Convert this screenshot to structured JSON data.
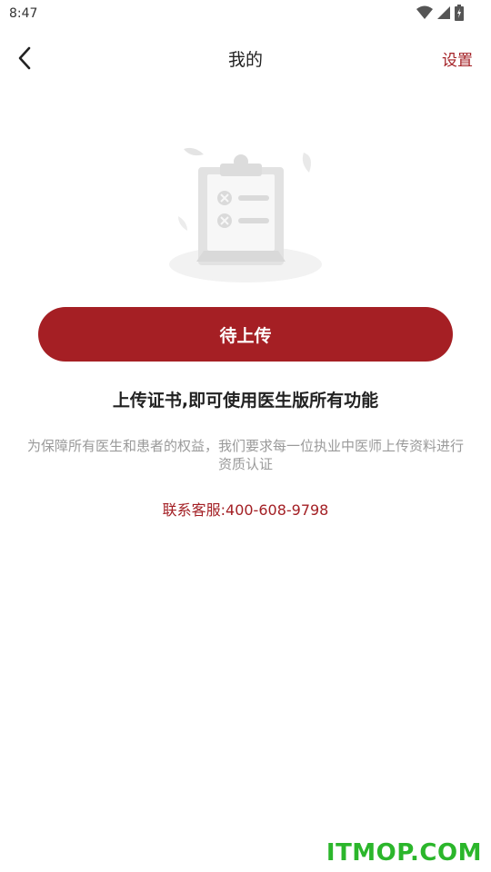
{
  "status_bar": {
    "time": "8:47"
  },
  "header": {
    "title": "我的",
    "settings_label": "设置"
  },
  "main": {
    "upload_button_label": "待上传",
    "headline": "上传证书,即可使用医生版所有功能",
    "description": "为保障所有医生和患者的权益，我们要求每一位执业中医师上传资料进行资质认证",
    "contact": "联系客服:400-608-9798"
  },
  "watermark": "ITMOP.COM",
  "colors": {
    "accent": "#a51f24",
    "muted_text": "#9a9a9a",
    "watermark": "#2bb62b"
  }
}
